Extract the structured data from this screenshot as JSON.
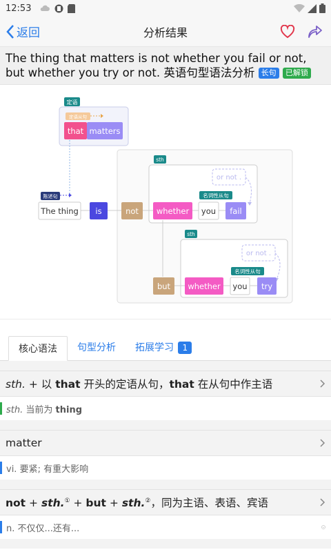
{
  "status": {
    "time": "12:53"
  },
  "topbar": {
    "back_label": "返回",
    "title": "分析结果"
  },
  "sentence": {
    "text": "The thing that matters is not whether you fail or not, but whether you try or not. 英语句型语法分析",
    "tag_long": "长句",
    "tag_unlocked": "已解锁"
  },
  "diagram": {
    "labels": {
      "attr_tag": "定语",
      "attr_clause": "定语从句",
      "that": "that",
      "matters": "matters",
      "decl_tag": "陈述句",
      "the_thing": "The thing",
      "is": "is",
      "not": "not",
      "sth1": "sth",
      "whether1": "whether",
      "you1": "you",
      "fail": "fail",
      "ornot1": "or not .",
      "noun_clause1": "名词性从句",
      "sth2": "sth",
      "but": "but",
      "whether2": "whether",
      "you2": "you",
      "try": "try",
      "ornot2": "or not .",
      "noun_clause2": "名词性从句"
    }
  },
  "tabs": [
    {
      "label": "核心语法"
    },
    {
      "label": "句型分析"
    },
    {
      "label": "拓展学习",
      "badge": "1"
    }
  ],
  "rules": [
    {
      "head_parts": [
        "sth.",
        " + 以 ",
        "that",
        " 开头的定语从句，",
        "that",
        " 在从句中作主语"
      ],
      "body_a": "sth.",
      "body_b": " 当前为 ",
      "body_c": "thing",
      "bar_color": "#2eaa4c"
    },
    {
      "head": "matter",
      "body": "vi. 要紧; 有重大影响",
      "bar_color": "#2b7de9"
    },
    {
      "head_parts": [
        "not",
        " + ",
        "sth.",
        "①",
        " + ",
        "but",
        " + ",
        "sth.",
        "②",
        "，同为主语、表语、宾语"
      ],
      "body": "n. 不仅仅...还有...",
      "bar_color": "#2b7de9"
    }
  ],
  "colors": {
    "accent": "#2b7de9",
    "pink": "#f2518d",
    "purple": "#9a8cf5",
    "tan": "#c9a57b",
    "navy": "#4b48e0",
    "teal": "#1a8a8a",
    "heart": "#e2384d"
  }
}
